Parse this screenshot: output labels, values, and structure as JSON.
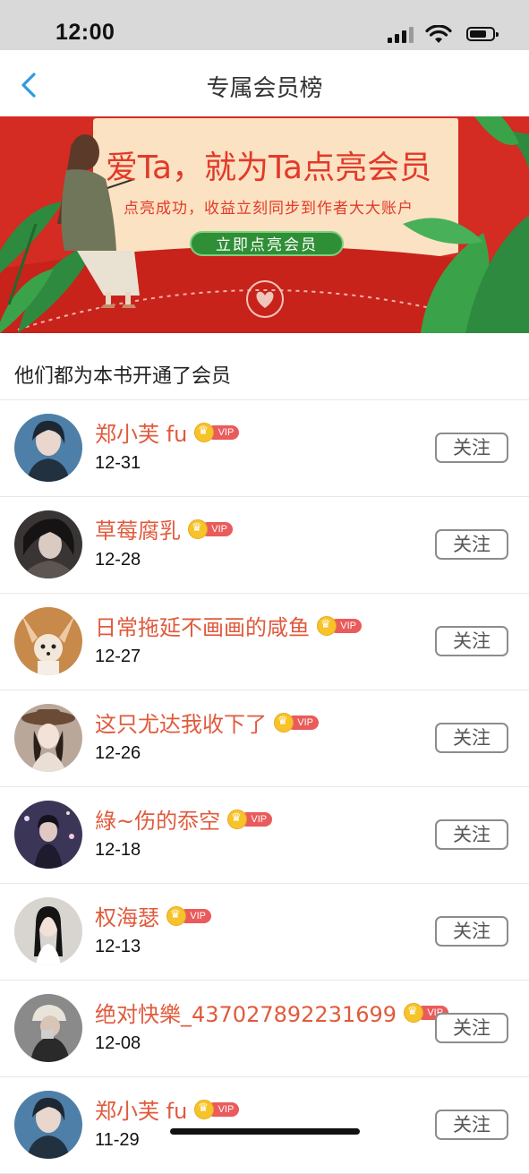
{
  "status_bar": {
    "time": "12:00"
  },
  "nav": {
    "title": "专属会员榜"
  },
  "banner": {
    "headline": "爱Ta，就为Ta点亮会员",
    "subtitle": "点亮成功，收益立刻同步到作者大大账户",
    "button_label": "立即点亮会员"
  },
  "section_title": "他们都为本书开通了会员",
  "members": [
    {
      "name": "郑小芙 fu",
      "date": "12-31",
      "vip": "VIP",
      "follow": "关注",
      "avatar_color": "#4d7fa8"
    },
    {
      "name": "草莓腐乳",
      "date": "12-28",
      "vip": "VIP",
      "follow": "关注",
      "avatar_color": "#3a3535"
    },
    {
      "name": "日常拖延不画画的咸鱼",
      "date": "12-27",
      "vip": "VIP",
      "follow": "关注",
      "avatar_color": "#c78a4a"
    },
    {
      "name": "这只尤达我收下了",
      "date": "12-26",
      "vip": "VIP",
      "follow": "关注",
      "avatar_color": "#b9a79a"
    },
    {
      "name": "綠~伤的忝空",
      "date": "12-18",
      "vip": "VIP",
      "follow": "关注",
      "avatar_color": "#3b3658"
    },
    {
      "name": "权海瑟",
      "date": "12-13",
      "vip": "VIP",
      "follow": "关注",
      "avatar_color": "#d8d4d0"
    },
    {
      "name": "绝对快樂_437027892231699",
      "date": "12-08",
      "vip": "VIP",
      "follow": "关注",
      "avatar_color": "#8a8a8a"
    },
    {
      "name": "郑小芙 fu",
      "date": "11-29",
      "vip": "VIP",
      "follow": "关注",
      "avatar_color": "#4d7fa8"
    }
  ],
  "colors": {
    "name_text": "#e05a3c",
    "banner_red": "#d42b22",
    "banner_card": "#fbe2c2",
    "banner_green": "#2f8f36"
  }
}
